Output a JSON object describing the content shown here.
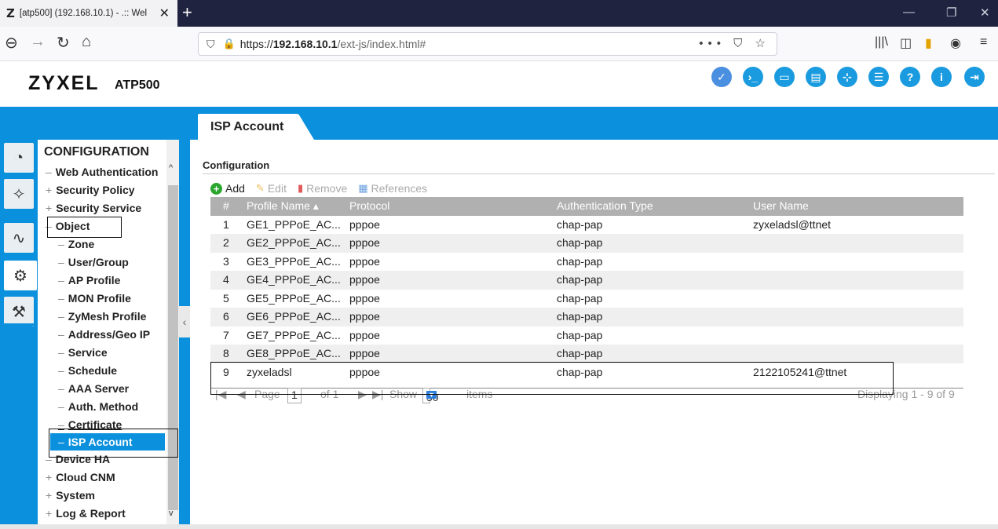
{
  "browser": {
    "tab_logo": "Z",
    "tab_title": "[atp500] (192.168.10.1) - .:: Wel",
    "url_host_prefix": "https://",
    "url_host": "192.168.10.1",
    "url_path": "/ext-js/index.html#",
    "url_actions": "••• ⛉ ☆"
  },
  "app": {
    "brand": "ZYXEL",
    "model": "ATP500",
    "page_tab": "ISP Account",
    "accent": "#0a90dc"
  },
  "sidebar": {
    "heading": "CONFIGURATION",
    "items": [
      {
        "prefix": "–",
        "label": "Web Authentication"
      },
      {
        "prefix": "+",
        "label": "Security Policy"
      },
      {
        "prefix": "+",
        "label": "Security Service"
      },
      {
        "prefix": "–",
        "label": "Object"
      },
      {
        "prefix": "–",
        "label": "Zone"
      },
      {
        "prefix": "–",
        "label": "User/Group"
      },
      {
        "prefix": "–",
        "label": "AP Profile"
      },
      {
        "prefix": "–",
        "label": "MON Profile"
      },
      {
        "prefix": "–",
        "label": "ZyMesh Profile"
      },
      {
        "prefix": "–",
        "label": "Address/Geo IP"
      },
      {
        "prefix": "–",
        "label": "Service"
      },
      {
        "prefix": "–",
        "label": "Schedule"
      },
      {
        "prefix": "–",
        "label": "AAA Server"
      },
      {
        "prefix": "–",
        "label": "Auth. Method"
      },
      {
        "prefix": "–",
        "label": "Certificate"
      },
      {
        "prefix": "–",
        "label": "ISP Account"
      },
      {
        "prefix": "–",
        "label": "Device HA"
      },
      {
        "prefix": "+",
        "label": "Cloud CNM"
      },
      {
        "prefix": "+",
        "label": "System"
      },
      {
        "prefix": "+",
        "label": "Log & Report"
      }
    ]
  },
  "main": {
    "section": "Configuration",
    "toolbar": {
      "add": "Add",
      "edit": "Edit",
      "remove": "Remove",
      "references": "References"
    },
    "columns": [
      "#",
      "Profile Name ▴",
      "Protocol",
      "Authentication Type",
      "User Name"
    ],
    "rows": [
      [
        "1",
        "GE1_PPPoE_AC...",
        "pppoe",
        "chap-pap",
        "zyxeladsl@ttnet"
      ],
      [
        "2",
        "GE2_PPPoE_AC...",
        "pppoe",
        "chap-pap",
        ""
      ],
      [
        "3",
        "GE3_PPPoE_AC...",
        "pppoe",
        "chap-pap",
        ""
      ],
      [
        "4",
        "GE4_PPPoE_AC...",
        "pppoe",
        "chap-pap",
        ""
      ],
      [
        "5",
        "GE5_PPPoE_AC...",
        "pppoe",
        "chap-pap",
        ""
      ],
      [
        "6",
        "GE6_PPPoE_AC...",
        "pppoe",
        "chap-pap",
        ""
      ],
      [
        "7",
        "GE7_PPPoE_AC...",
        "pppoe",
        "chap-pap",
        ""
      ],
      [
        "8",
        "GE8_PPPoE_AC...",
        "pppoe",
        "chap-pap",
        ""
      ],
      [
        "9",
        "zyxeladsl",
        "pppoe",
        "chap-pap",
        "2122105241@ttnet"
      ]
    ],
    "pager": {
      "page_label": "Page",
      "page_value": "1",
      "of_label": "of 1",
      "show_label": "Show",
      "show_value": "50",
      "items_label": "items",
      "displaying": "Displaying 1 - 9 of 9"
    }
  }
}
